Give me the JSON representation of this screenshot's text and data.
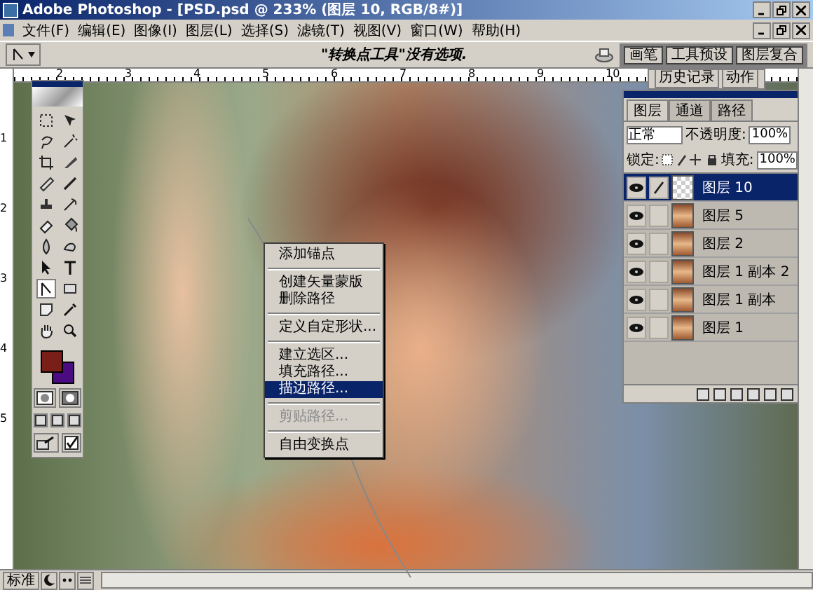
{
  "window": {
    "title": "Adobe Photoshop - [PSD.psd @ 233% (图层 10, RGB/8#)]"
  },
  "menu": [
    "文件(F)",
    "编辑(E)",
    "图像(I)",
    "图层(L)",
    "选择(S)",
    "滤镜(T)",
    "视图(V)",
    "窗口(W)",
    "帮助(H)"
  ],
  "options_bar": {
    "hint": "\"转换点工具\"没有选项."
  },
  "palette_well": {
    "tabs": [
      "画笔",
      "工具预设",
      "图层复合"
    ]
  },
  "rulers": {
    "horizontal": [
      "2",
      "3",
      "4",
      "5",
      "6",
      "7",
      "8",
      "9",
      "10"
    ],
    "vertical": [
      "1",
      "2",
      "3",
      "4",
      "5"
    ]
  },
  "toolbox": {
    "tools": [
      {
        "kind": "marquee",
        "selected": false
      },
      {
        "kind": "move",
        "selected": false
      },
      {
        "kind": "lasso",
        "selected": false
      },
      {
        "kind": "wand",
        "selected": false
      },
      {
        "kind": "crop",
        "selected": false
      },
      {
        "kind": "slice",
        "selected": false
      },
      {
        "kind": "bandage",
        "selected": false
      },
      {
        "kind": "brush",
        "selected": false
      },
      {
        "kind": "stamp",
        "selected": false
      },
      {
        "kind": "history",
        "selected": false
      },
      {
        "kind": "eraser",
        "selected": false
      },
      {
        "kind": "bucket",
        "selected": false
      },
      {
        "kind": "blur",
        "selected": false
      },
      {
        "kind": "smudge",
        "selected": false
      },
      {
        "kind": "arrow",
        "selected": false
      },
      {
        "kind": "type",
        "selected": false
      },
      {
        "kind": "pen",
        "selected": true
      },
      {
        "kind": "shape",
        "selected": false
      },
      {
        "kind": "note",
        "selected": false
      },
      {
        "kind": "eyedropper",
        "selected": false
      },
      {
        "kind": "hand",
        "selected": false
      },
      {
        "kind": "zoom",
        "selected": false
      }
    ],
    "swatches": [
      {
        "color": "#7a1e18"
      },
      {
        "color": "#4a0c80"
      }
    ]
  },
  "context_menu": {
    "groups": [
      [
        {
          "label": "添加锚点",
          "selected": false,
          "disabled": false
        }
      ],
      [
        {
          "label": "创建矢量蒙版",
          "selected": false,
          "disabled": false
        },
        {
          "label": "删除路径",
          "selected": false,
          "disabled": false
        }
      ],
      [
        {
          "label": "定义自定形状...",
          "selected": false,
          "disabled": false
        }
      ],
      [
        {
          "label": "建立选区...",
          "selected": false,
          "disabled": false
        },
        {
          "label": "填充路径...",
          "selected": false,
          "disabled": false
        },
        {
          "label": "描边路径...",
          "selected": true,
          "disabled": false
        }
      ],
      [
        {
          "label": "剪贴路径...",
          "selected": false,
          "disabled": true
        }
      ],
      [
        {
          "label": "自由变换点",
          "selected": false,
          "disabled": false
        }
      ]
    ]
  },
  "history_panel": {
    "tabs": [
      "历史记录",
      "动作"
    ]
  },
  "layers_panel": {
    "tabs": [
      {
        "label": "图层",
        "selected": true
      },
      {
        "label": "通道",
        "selected": false
      },
      {
        "label": "路径",
        "selected": false
      }
    ],
    "blend_mode": "正常",
    "opacity_label": "不透明度:",
    "opacity": "100%",
    "lock_label": "锁定:",
    "fill_label": "填充:",
    "fill": "100%",
    "layers": [
      {
        "name": "图层 10",
        "selected": true,
        "visible": true,
        "linked": true,
        "kind": "empty"
      },
      {
        "name": "图层 5",
        "selected": false,
        "visible": true,
        "linked": false,
        "kind": "photo"
      },
      {
        "name": "图层 2",
        "selected": false,
        "visible": true,
        "linked": false,
        "kind": "photo"
      },
      {
        "name": "图层 1 副本 2",
        "selected": false,
        "visible": true,
        "linked": false,
        "kind": "photo"
      },
      {
        "name": "图层 1 副本",
        "selected": false,
        "visible": true,
        "linked": false,
        "kind": "photo"
      },
      {
        "name": "图层 1",
        "selected": false,
        "visible": true,
        "linked": false,
        "kind": "photo"
      }
    ]
  },
  "status_bar": {
    "mode": "标准"
  }
}
